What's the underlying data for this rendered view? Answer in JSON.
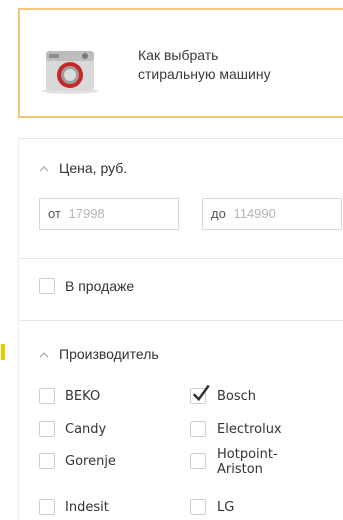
{
  "promo": {
    "line1": "Как выбрать",
    "line2": "стиральную машину",
    "image_icon": "washing-machine-icon"
  },
  "price": {
    "title": "Цена, руб.",
    "from_prefix": "от",
    "from_placeholder": "17998",
    "to_prefix": "до",
    "to_placeholder": "114990"
  },
  "availability": {
    "label": "В продаже",
    "checked": false
  },
  "manufacturer": {
    "title": "Производитель",
    "items": [
      {
        "label": "BEKO",
        "checked": false
      },
      {
        "label": "Bosch",
        "checked": true
      },
      {
        "label": "Candy",
        "checked": false
      },
      {
        "label": "Electrolux",
        "checked": false
      },
      {
        "label": "Gorenje",
        "checked": false
      },
      {
        "label": "Hotpoint-Ariston",
        "line1": "Hotpoint-",
        "line2": "Ariston",
        "checked": false
      },
      {
        "label": "Indesit",
        "checked": false
      },
      {
        "label": "LG",
        "checked": false
      }
    ]
  },
  "colors": {
    "accent": "#f2c200",
    "promo_border": "#f5c67a",
    "check": "#333333"
  }
}
